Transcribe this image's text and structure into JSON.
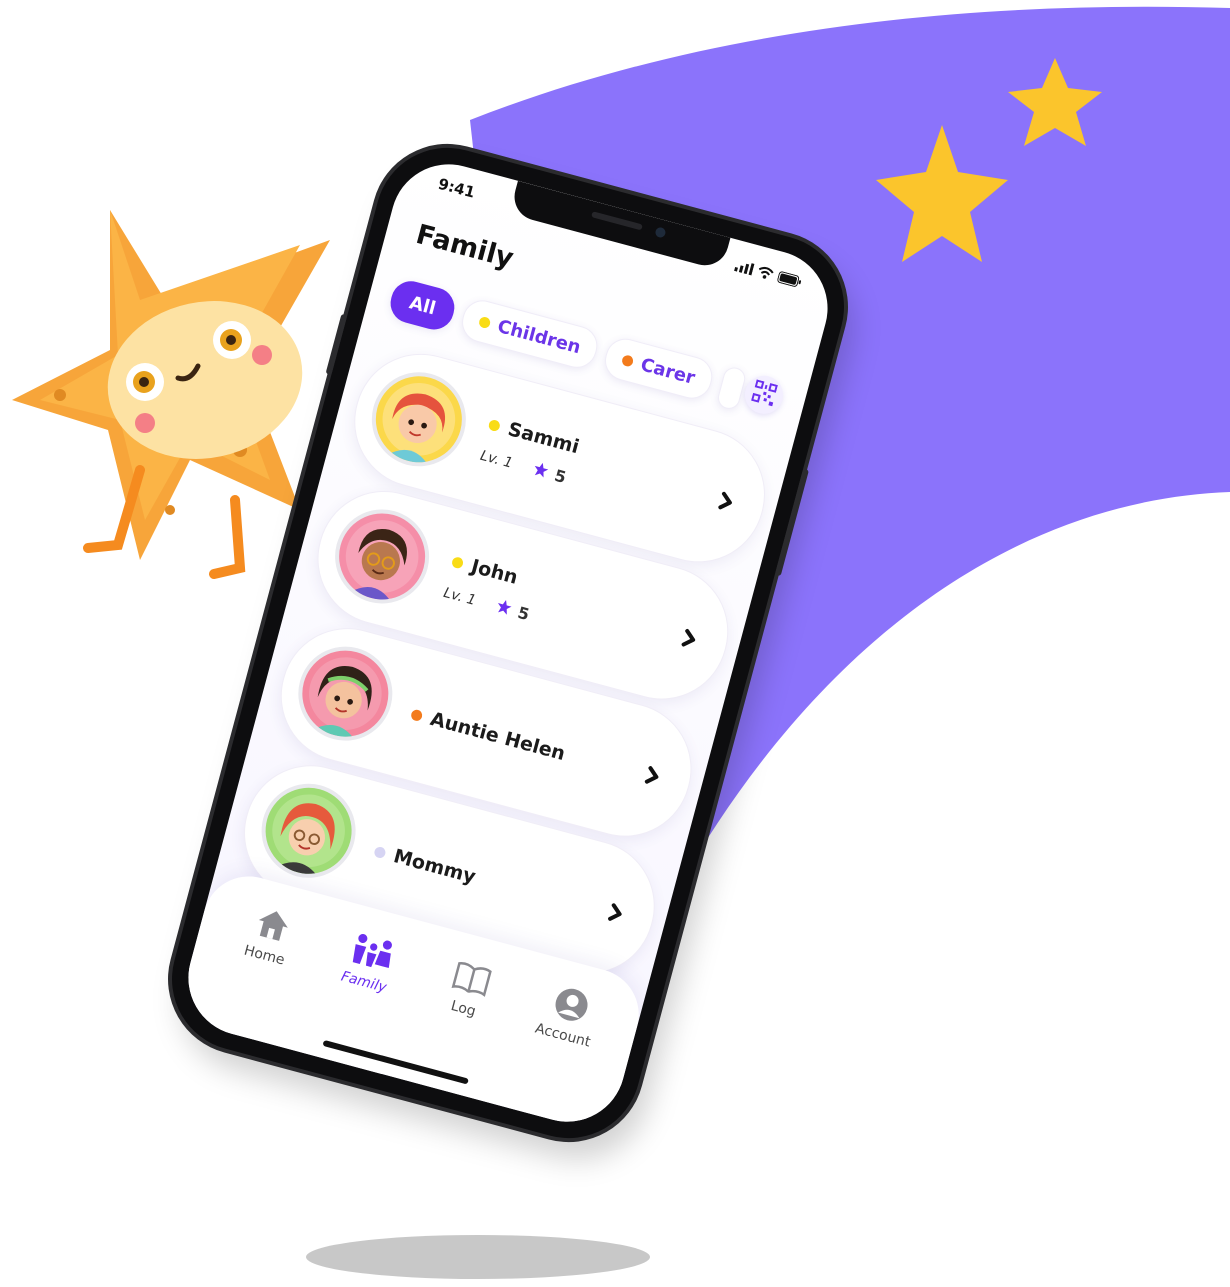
{
  "colors": {
    "background": "#ffffff",
    "swoosh": "#8b73fb",
    "star": "#fbc52c",
    "accent": "#6b2ff0",
    "children_dot": "#f9dc16",
    "carer_dot": "#f37b1c",
    "other_dot": "#d6d4f3"
  },
  "status_bar": {
    "time": "9:41",
    "icons": [
      "signal-icon",
      "wifi-icon",
      "battery-icon"
    ]
  },
  "page": {
    "title": "Family",
    "qr_button_icon": "qr-code-icon"
  },
  "filters": [
    {
      "label": "All",
      "active": true
    },
    {
      "label": "Children",
      "dot_color": "#f9dc16"
    },
    {
      "label": "Carer",
      "dot_color": "#f37b1c"
    }
  ],
  "members": [
    {
      "name": "Sammi",
      "dot_color": "#f9dc16",
      "level": "Lv. 1",
      "stars": "5",
      "avatar_bg": "#fbd84a"
    },
    {
      "name": "John",
      "dot_color": "#f9dc16",
      "level": "Lv. 1",
      "stars": "5",
      "avatar_bg": "#f58ea8"
    },
    {
      "name": "Auntie Helen",
      "dot_color": "#f37b1c",
      "avatar_bg": "#f4879e"
    },
    {
      "name": "Mommy",
      "dot_color": "#d6d4f3",
      "avatar_bg": "#9fdc75"
    }
  ],
  "bottom_nav": [
    {
      "label": "Home",
      "icon": "home-icon"
    },
    {
      "label": "Family",
      "icon": "family-icon",
      "active": true
    },
    {
      "label": "Log",
      "icon": "book-icon"
    },
    {
      "label": "Account",
      "icon": "account-icon"
    }
  ]
}
